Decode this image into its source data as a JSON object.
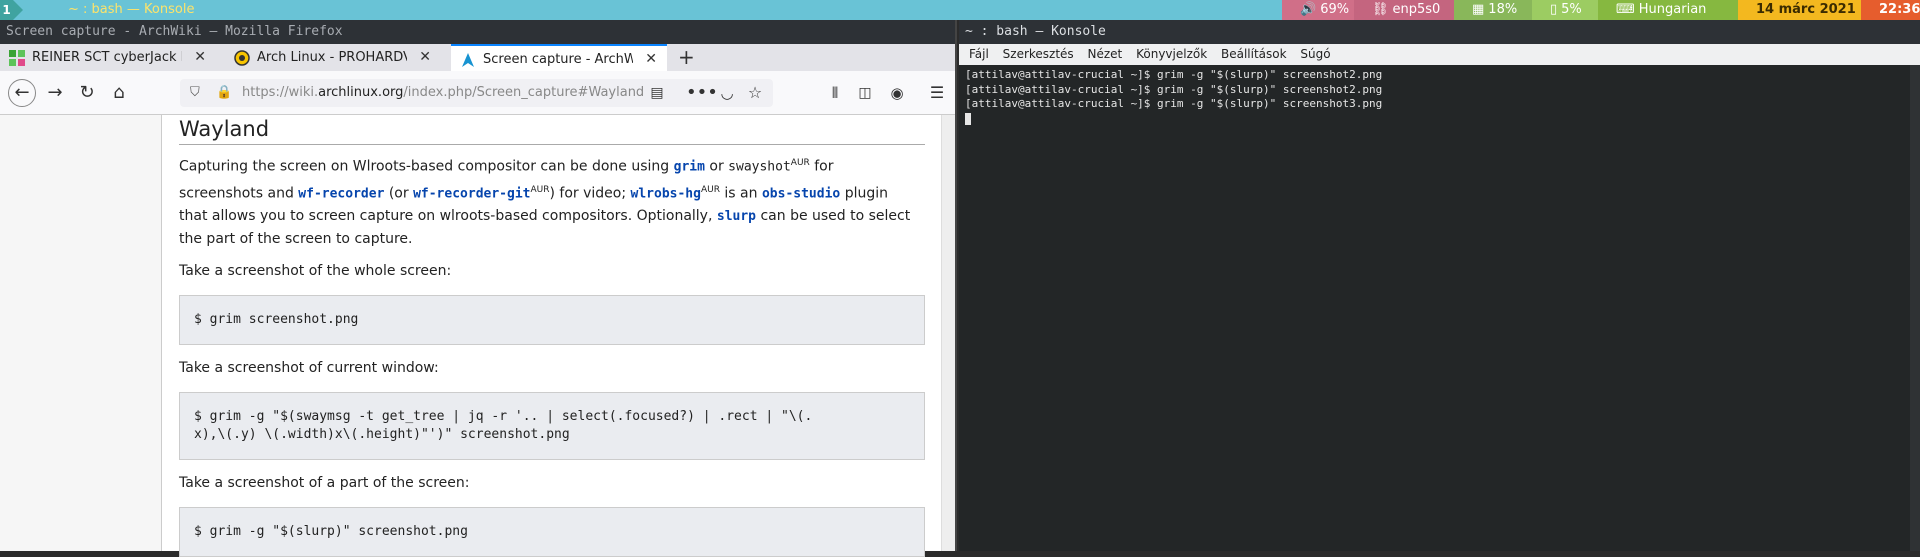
{
  "topbar": {
    "workspace": "1",
    "window_title": "~ : bash — Konsole",
    "volume": "69%",
    "network": "enp5s0",
    "cpu": "18%",
    "battery": "5%",
    "keyboard": "Hungarian",
    "date": "14 márc 2021",
    "time": "22:36"
  },
  "firefox": {
    "title": "Screen capture - ArchWiki — Mozilla Firefox",
    "tabs": [
      {
        "label": "REINER SCT cyberJack RFID"
      },
      {
        "label": "Arch Linux - PROHARDVER"
      },
      {
        "label": "Screen capture - ArchWiki"
      }
    ],
    "url_prefix": "https://wiki.",
    "url_domain": "archlinux.org",
    "url_rest": "/index.php/Screen_capture#Wayland"
  },
  "article": {
    "heading": "Wayland",
    "p1": {
      "t1": "Capturing the screen on Wlroots-based compositor can be done using ",
      "grim": "grim",
      "t2": " or ",
      "swayshot": "swayshot",
      "aur1": "AUR",
      "t3": " for screenshots and ",
      "wfrec": "wf-recorder",
      "t4": " (or ",
      "wfrecgit": "wf-recorder-git",
      "aur2": "AUR",
      "t5": ") for video; ",
      "wlrobs": "wlrobs-hg",
      "aur3": "AUR",
      "t6": " is an ",
      "obs": "obs-studio",
      "t7": " plugin that allows you to screen capture on wlroots-based compositors. Optionally, ",
      "slurp": "slurp",
      "t8": " can be used to select the part of the screen to capture."
    },
    "p2": "Take a screenshot of the whole screen:",
    "code1": "$ grim screenshot.png",
    "p3": "Take a screenshot of current window:",
    "code2": "$ grim -g \"$(swaymsg -t get_tree | jq -r '.. | select(.focused?) | .rect | \"\\(.\nx),\\(.y) \\(.width)x\\(.height)\"')\" screenshot.png",
    "p4": "Take a screenshot of a part of the screen:",
    "code3": "$ grim -g \"$(slurp)\" screenshot.png"
  },
  "konsole": {
    "title": "~ : bash — Konsole",
    "menu": [
      "Fájl",
      "Szerkesztés",
      "Nézet",
      "Könyvjelzők",
      "Beállítások",
      "Súgó"
    ],
    "lines": [
      "[attilav@attilav-crucial ~]$ grim -g \"$(slurp)\" screenshot2.png",
      "[attilav@attilav-crucial ~]$ grim -g \"$(slurp)\" screenshot2.png",
      "[attilav@attilav-crucial ~]$ grim -g \"$(slurp)\" screenshot3.png"
    ]
  },
  "colors": {
    "accent_tab": "#0a84ff",
    "wiki_link": "#0645ad",
    "terminal_bg": "#232627"
  }
}
